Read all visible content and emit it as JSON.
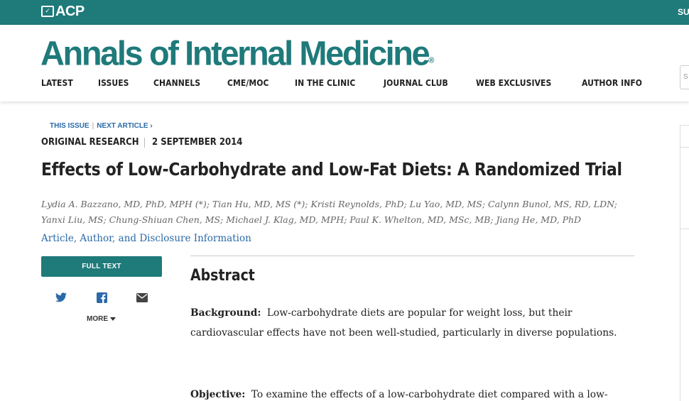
{
  "topbar": {
    "logo_text": "ACP",
    "right_text": "SU",
    "color": "#1f7a7a"
  },
  "masthead": {
    "journal_title": "Annals of Internal Medicine",
    "registered_mark": "®",
    "search_placeholder": "S",
    "nav": [
      {
        "label": "LATEST"
      },
      {
        "label": "ISSUES"
      },
      {
        "label": "CHANNELS"
      },
      {
        "label": "CME/MOC"
      },
      {
        "label": "IN THE CLINIC"
      },
      {
        "label": "JOURNAL CLUB"
      },
      {
        "label": "WEB EXCLUSIVES"
      },
      {
        "label": "AUTHOR INFO"
      }
    ]
  },
  "article": {
    "this_issue_link": "THIS ISSUE",
    "next_article_link": "NEXT ARTICLE ›",
    "type": "ORIGINAL RESEARCH",
    "date": "2 SEPTEMBER 2014",
    "title": "Effects of Low-Carbohydrate and Low-Fat Diets: A Randomized Trial",
    "authors": "Lydia A. Bazzano, MD, PhD, MPH (*); Tian Hu, MD, MS (*); Kristi Reynolds, PhD; Lu Yao, MD, MS; Calynn Bunol, MS, RD, LDN; Yanxi Liu, MS; Chung-Shiuan Chen, MS; Michael J. Klag, MD, MPH; Paul K. Whelton, MD, MSc, MB; Jiang He, MD, PhD",
    "info_link": "Article, Author, and Disclosure Information"
  },
  "sidebar": {
    "full_text_button": "FULL TEXT",
    "share_icons": [
      "twitter-icon",
      "facebook-icon",
      "email-icon"
    ],
    "more_label": "MORE"
  },
  "abstract": {
    "heading": "Abstract",
    "background_label": "Background:",
    "background_text": "Low-carbohydrate diets are popular for weight loss, but their cardiovascular effects have not been well-studied, particularly in diverse populations.",
    "objective_label": "Objective:",
    "objective_text": "To examine the effects of a low-carbohydrate diet compared with a low-"
  },
  "colors": {
    "brand_teal": "#1f7a7a",
    "link_blue": "#2a6aa8"
  }
}
